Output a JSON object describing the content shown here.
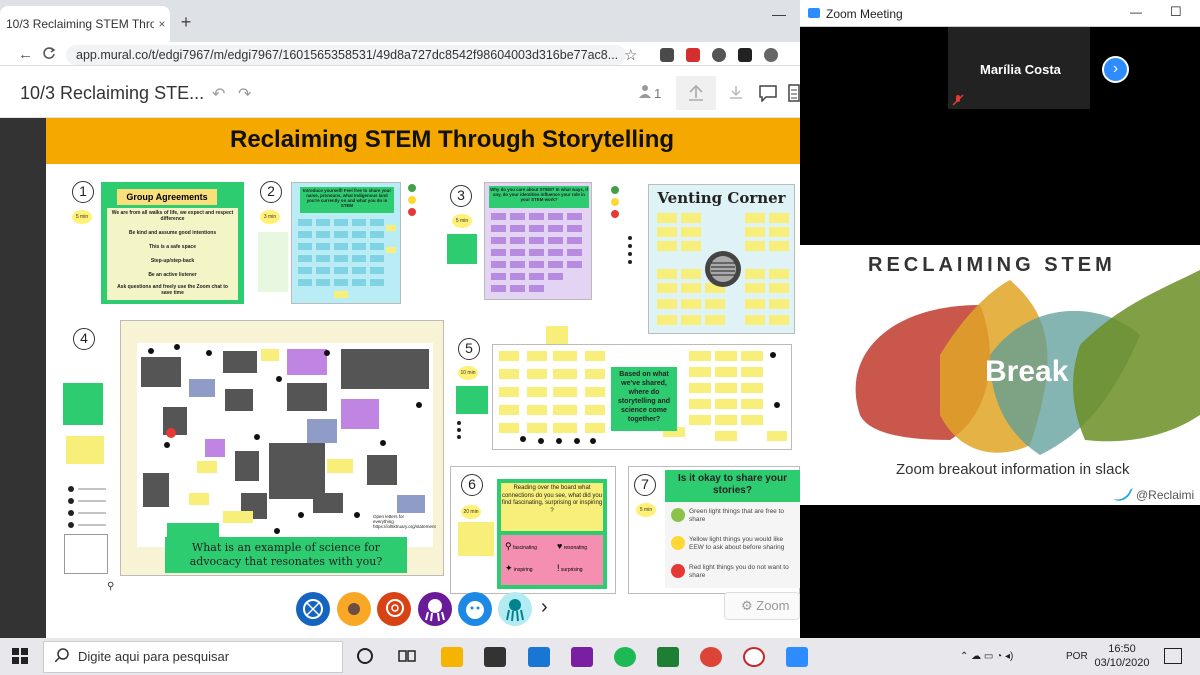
{
  "browser": {
    "tab_title": "10/3 Reclaiming STEM Through S",
    "tab_close": "×",
    "new_tab": "+",
    "minimize": "—",
    "back": "←",
    "reload": "C",
    "url": "app.mural.co/t/edgi7967/m/edgi7967/1601565358531/49d8a727dc8542f98604003d316be77ac8...",
    "star": "☆"
  },
  "mural": {
    "board_title": "10/3 Reclaiming STE...",
    "user_count": "1",
    "banner_title": "Reclaiming STEM Through Storytelling",
    "sections": [
      {
        "number": "1",
        "time": "5 min"
      },
      {
        "number": "2",
        "time": "3 min"
      },
      {
        "number": "3",
        "time": "5 min"
      },
      {
        "number": "4",
        "time": ""
      },
      {
        "number": "5",
        "time": "10 min"
      },
      {
        "number": "6",
        "time": "20 min"
      },
      {
        "number": "7",
        "time": "5 min"
      }
    ],
    "agreements": {
      "title": "Group Agreements",
      "lines": [
        "We are from all walks of life, we expect and respect difference",
        "Be kind and assume good intentions",
        "This is a safe space",
        "Step-up/step-back",
        "Be an active listener",
        "Ask questions and freely use the Zoom chat to save time"
      ]
    },
    "intro_prompt": "Introduce yourself! Feel free to share your name, pronouns, what Indigenous land you're currently on and what you do in STEM",
    "why_prompt": "Why do you care about STEM? In what ways, if any, do your identities influence your role in your STEM work?",
    "venting_title": "Venting Corner",
    "advocacy_prompt": "What is an example of science for advocacy that resonates with you?",
    "storytelling_prompt": "Based on what we've shared, where do storytelling and science come together?",
    "reading_prompt": "Reading over the board what connections do you see, what did you find fascinating, surprising or inspiring ?",
    "reading_labels": [
      "fascinating",
      "resonating",
      "inspiring",
      "surprising"
    ],
    "okay_prompt": "Is it okay to share your stories?",
    "okay_items": [
      {
        "color": "#8bc34a",
        "text": "Green light things that are free to share"
      },
      {
        "color": "#fdd835",
        "text": "Yellow light things you would like EEW to ask about before sharing"
      },
      {
        "color": "#e53935",
        "text": "Red light things you do not want to share"
      }
    ],
    "key_labels": [
      "fascinating",
      "inspiring",
      "resonating",
      "surprising"
    ],
    "open_letters": "Open letters for everything https://iol5ktruary.org/statement",
    "zoom_btn": "⚙ Zoom"
  },
  "zoom": {
    "window_title": "Zoom Meeting",
    "participant": "Marília Costa",
    "slide_title": "RECLAIMING STEM",
    "slide_center": "Break",
    "slide_caption": "Zoom breakout information in slack",
    "slide_handle": "@Reclaimi",
    "controls": [
      "—",
      "☐",
      "✕"
    ]
  },
  "taskbar": {
    "search_placeholder": "Digite aqui para pesquisar",
    "language": "POR",
    "time": "16:50",
    "date": "03/10/2020"
  }
}
